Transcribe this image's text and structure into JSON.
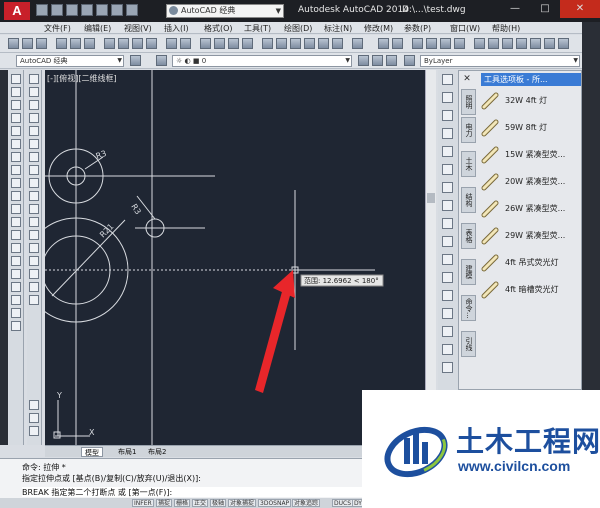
{
  "titlebar": {
    "logo": "A",
    "workspace": "AutoCAD 经典",
    "app_title": "Autodesk AutoCAD 2014",
    "doc_title": "D:\\...\\test.dwg",
    "min": "—",
    "max": "□",
    "close": "✕"
  },
  "menu": [
    "文件(F)",
    "编辑(E)",
    "视图(V)",
    "插入(I)",
    "格式(O)",
    "工具(T)",
    "绘图(D)",
    "标注(N)",
    "修改(M)",
    "参数(P)",
    "窗口(W)",
    "帮助(H)"
  ],
  "toolbar": {
    "workspace_combo": "AutoCAD 经典",
    "layer_combo": "0",
    "bylayer_combo": "ByLayer"
  },
  "canvas": {
    "viewport_label": "[-][俯视][二维线框]",
    "dim_r3_a": "R3",
    "dim_r3_b": "R3",
    "dim_r21": "R21",
    "tooltip": "范围: 12.6962 < 180°",
    "ucs_x": "X",
    "ucs_y": "Y"
  },
  "palette": {
    "title": "工具选项板 - 所...",
    "close": "✕",
    "tabs": [
      "照明",
      "电力",
      "土木",
      "结构",
      "表格",
      "建模",
      "命令...",
      "引线"
    ],
    "items": [
      {
        "label": "32W 4ft 灯"
      },
      {
        "label": "59W 8ft 灯"
      },
      {
        "label": "15W 紧凑型荧..."
      },
      {
        "label": "20W 紧凑型荧..."
      },
      {
        "label": "26W 紧凑型荧..."
      },
      {
        "label": "29W 紧凑型荧..."
      },
      {
        "label": "4ft 吊式荧光灯"
      },
      {
        "label": "4ft 暗槽荧光灯"
      }
    ]
  },
  "layout_tabs": [
    "模型",
    "布局1",
    "布局2"
  ],
  "command": {
    "line1": "命令: 拉伸 *",
    "line2": "指定拉伸点或 [基点(B)/复制(C)/放弃(U)/退出(X)]:",
    "prompt": "BREAK 指定第二个打断点 或 [第一点(F)]:"
  },
  "status": [
    "INFER",
    "捕捉",
    "栅格",
    "正交",
    "极轴",
    "对象捕捉",
    "3DOSNAP",
    "对象追踪",
    "DUCS",
    "DYN"
  ],
  "watermark": {
    "name": "土木工程网",
    "url": "www.civilcn.com"
  },
  "colors": {
    "canvas_bg": "#1f2633",
    "arrow": "#e8262a",
    "brand_blue": "#1d4f9e",
    "palette_title": "#3a7bd5"
  }
}
